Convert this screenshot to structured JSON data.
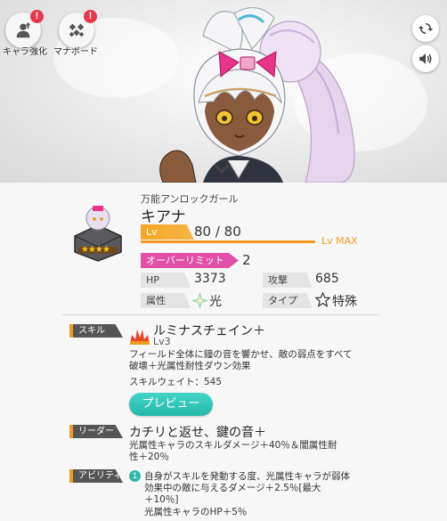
{
  "top_buttons": {
    "chara_boost_label": "キャラ強化",
    "mana_board_label": "マナボード",
    "alert_mark": "!"
  },
  "character": {
    "subtitle": "万能アンロックガール",
    "name": "キアナ",
    "stars": "★★★★"
  },
  "level": {
    "tag": "Lv",
    "value": "80 / 80",
    "max_label": "Lv MAX",
    "progress": 1.0
  },
  "overlimit": {
    "tag": "オーバーリミット",
    "value": "2"
  },
  "stats": {
    "hp_label": "HP",
    "hp_value": "3373",
    "attack_label": "攻撃",
    "attack_value": "685",
    "attribute_label": "属性",
    "attribute_value": "光",
    "type_label": "タイプ",
    "type_value": "特殊"
  },
  "skill": {
    "section_label": "スキル",
    "name": "ルミナスチェイン＋",
    "level": "Lv3",
    "desc_line1": "フィールド全体に鐘の音を響かせ、敵の弱点をすべて",
    "desc_line2": "破壊＋光属性耐性ダウン効果",
    "weight": "スキルウェイト：545",
    "preview_label": "プレビュー"
  },
  "leader": {
    "section_label": "リーダー",
    "name": "カチリと返せ、鍵の音＋",
    "desc_line1": "光属性キャラのスキルダメージ＋40％＆闇属性耐",
    "desc_line2": "性＋20％"
  },
  "ability": {
    "section_label": "アビリティ",
    "number": "1",
    "desc_line1": "自身がスキルを発動する度、光属性キャラが弱体",
    "desc_line2": "効果中の敵に与えるダメージ＋2.5％[最大",
    "desc_line3": "＋10％]",
    "desc_line4": "光属性キャラのHP＋5％"
  },
  "colors": {
    "accent_orange": "#f29c1f",
    "accent_pink": "#e24fa6",
    "accent_teal": "#2fbfb1",
    "alert_red": "#e5384a"
  }
}
